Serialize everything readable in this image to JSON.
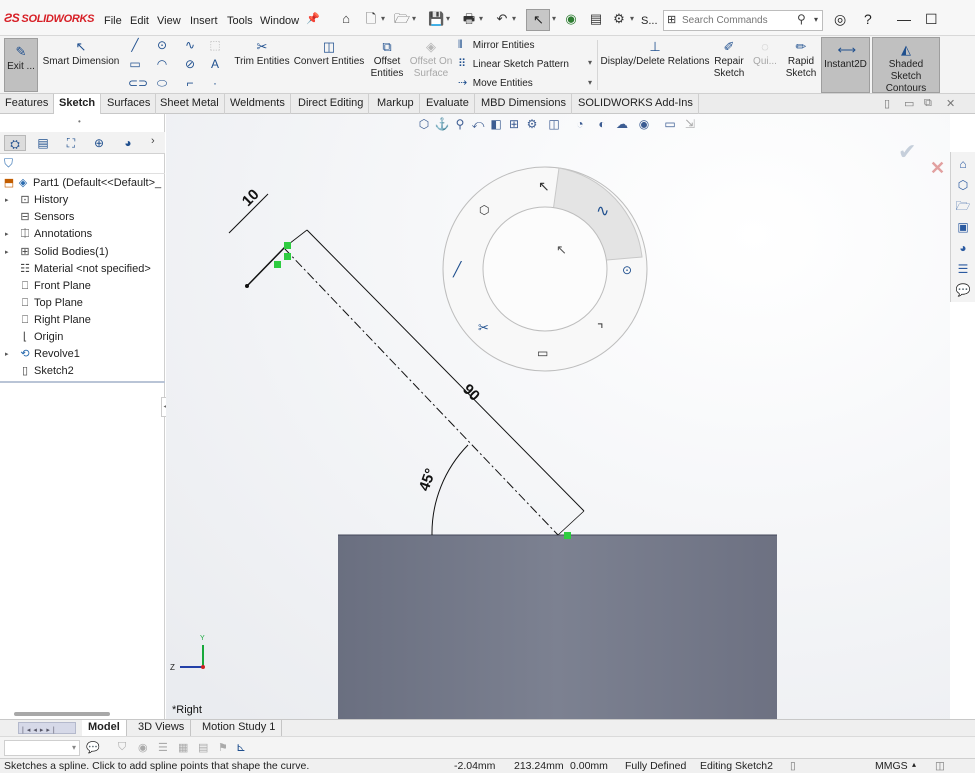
{
  "app": {
    "logo": "SOLIDWORKS",
    "menu": [
      "File",
      "Edit",
      "View",
      "Insert",
      "Tools",
      "Window"
    ],
    "search_placeholder": "Search Commands",
    "toolbar_truncated_label": "S..."
  },
  "command_manager": {
    "exit_sketch": "Exit ...",
    "smart_dimension": "Smart Dimension",
    "trim_entities": "Trim Entities",
    "convert_entities": "Convert Entities",
    "offset_entities": [
      "Offset",
      "Entities"
    ],
    "offset_on_surface": [
      "Offset On",
      "Surface"
    ],
    "mirror_entities": "Mirror Entities",
    "linear_sketch_pattern": "Linear Sketch Pattern",
    "move_entities": "Move Entities",
    "display_delete_relations": "Display/Delete Relations",
    "repair_sketch": [
      "Repair",
      "Sketch"
    ],
    "quick_snaps": "Qui...",
    "rapid_sketch": [
      "Rapid",
      "Sketch"
    ],
    "instant2d": "Instant2D",
    "shaded_sketch_contours": [
      "Shaded Sketch",
      "Contours"
    ]
  },
  "tabs": [
    "Features",
    "Sketch",
    "Surfaces",
    "Sheet Metal",
    "Weldments",
    "Direct Editing",
    "Markup",
    "Evaluate",
    "MBD Dimensions",
    "SOLIDWORKS Add-Ins"
  ],
  "active_tab": "Sketch",
  "feature_tree": {
    "root": "Part1  (Default<<Default>_",
    "items": [
      {
        "label": "History",
        "icon": "history-icon",
        "expandable": true
      },
      {
        "label": "Sensors",
        "icon": "sensors-icon",
        "expandable": false
      },
      {
        "label": "Annotations",
        "icon": "annotations-icon",
        "expandable": true
      },
      {
        "label": "Solid Bodies(1)",
        "icon": "solid-bodies-icon",
        "expandable": true
      },
      {
        "label": "Material <not specified>",
        "icon": "material-icon",
        "expandable": false
      },
      {
        "label": "Front Plane",
        "icon": "plane-icon",
        "expandable": false
      },
      {
        "label": "Top Plane",
        "icon": "plane-icon",
        "expandable": false
      },
      {
        "label": "Right Plane",
        "icon": "plane-icon",
        "expandable": false
      },
      {
        "label": "Origin",
        "icon": "origin-icon",
        "expandable": false
      },
      {
        "label": "Revolve1",
        "icon": "revolve-icon",
        "expandable": true
      },
      {
        "label": "Sketch2",
        "icon": "sketch-icon",
        "expandable": false
      }
    ]
  },
  "graphics": {
    "view_name": "*Right",
    "dimensions": {
      "width": "10",
      "length": "90",
      "angle": "45°"
    },
    "triad": {
      "y": "Y",
      "z": "Z"
    }
  },
  "bottom_tabs": [
    "Model",
    "3D Views",
    "Motion Study 1"
  ],
  "active_bottom_tab": "Model",
  "status": {
    "message": "Sketches a spline. Click to add spline points that shape the curve.",
    "x": "-2.04mm",
    "y": "213.24mm",
    "z": "0.00mm",
    "definition": "Fully Defined",
    "editing": "Editing Sketch2",
    "units": "MMGS"
  },
  "colors": {
    "accent": "#1f4f8e",
    "brand": "#d71f26",
    "sketch_point": "#2ecc40",
    "body": "#757a8a"
  }
}
